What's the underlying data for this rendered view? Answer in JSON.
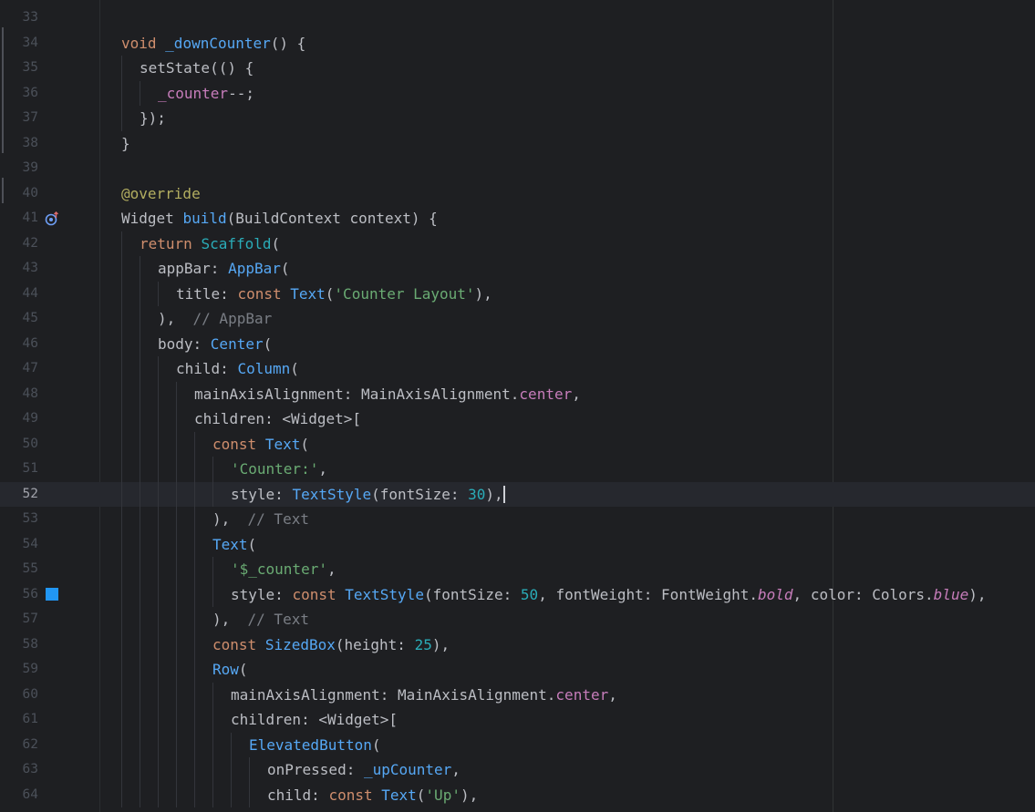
{
  "editor": {
    "current_line": 52,
    "colors": {
      "background": "#1e1f22",
      "keyword": "#cf8e6d",
      "function": "#56a8f5",
      "class": "#2aacb8",
      "string": "#6aab73",
      "number": "#2aacb8",
      "field": "#c77dbb",
      "comment": "#7a7e85",
      "annotation": "#b3ae60",
      "color_swatch": "#2196f3"
    },
    "gutter_icons": {
      "line_41": "override-method-icon",
      "line_56": "color-swatch-icon"
    },
    "lines": [
      {
        "n": "33",
        "indent": 0,
        "tokens": []
      },
      {
        "n": "34",
        "indent": 0,
        "tokens": [
          {
            "t": "void",
            "c": "kw"
          },
          {
            "t": " "
          },
          {
            "t": "_downCounter",
            "c": "fn"
          },
          {
            "t": "() {"
          }
        ]
      },
      {
        "n": "35",
        "indent": 1,
        "tokens": [
          {
            "t": "setState"
          },
          {
            "t": "(() {"
          }
        ]
      },
      {
        "n": "36",
        "indent": 2,
        "tokens": [
          {
            "t": "_counter",
            "c": "field"
          },
          {
            "t": "--;"
          }
        ]
      },
      {
        "n": "37",
        "indent": 1,
        "tokens": [
          {
            "t": "});"
          }
        ]
      },
      {
        "n": "38",
        "indent": 0,
        "tokens": [
          {
            "t": "}"
          }
        ]
      },
      {
        "n": "39",
        "indent": 0,
        "tokens": []
      },
      {
        "n": "40",
        "indent": 0,
        "tokens": [
          {
            "t": "@override",
            "c": "ann"
          }
        ]
      },
      {
        "n": "41",
        "indent": 0,
        "tokens": [
          {
            "t": "Widget"
          },
          {
            "t": " "
          },
          {
            "t": "build",
            "c": "fn"
          },
          {
            "t": "(BuildContext context) {"
          }
        ]
      },
      {
        "n": "42",
        "indent": 1,
        "tokens": [
          {
            "t": "return",
            "c": "kw"
          },
          {
            "t": " "
          },
          {
            "t": "Scaffold",
            "c": "cls"
          },
          {
            "t": "("
          }
        ]
      },
      {
        "n": "43",
        "indent": 2,
        "tokens": [
          {
            "t": "appBar: "
          },
          {
            "t": "AppBar",
            "c": "cls2"
          },
          {
            "t": "("
          }
        ]
      },
      {
        "n": "44",
        "indent": 3,
        "tokens": [
          {
            "t": "title: "
          },
          {
            "t": "const",
            "c": "kw"
          },
          {
            "t": " "
          },
          {
            "t": "Text",
            "c": "cls2"
          },
          {
            "t": "("
          },
          {
            "t": "'Counter Layout'",
            "c": "str"
          },
          {
            "t": "),"
          }
        ]
      },
      {
        "n": "45",
        "indent": 2,
        "tokens": [
          {
            "t": "),  "
          },
          {
            "t": "// AppBar",
            "c": "cmt"
          }
        ]
      },
      {
        "n": "46",
        "indent": 2,
        "tokens": [
          {
            "t": "body: "
          },
          {
            "t": "Center",
            "c": "cls2"
          },
          {
            "t": "("
          }
        ]
      },
      {
        "n": "47",
        "indent": 3,
        "tokens": [
          {
            "t": "child: "
          },
          {
            "t": "Column",
            "c": "cls2"
          },
          {
            "t": "("
          }
        ]
      },
      {
        "n": "48",
        "indent": 4,
        "tokens": [
          {
            "t": "mainAxisAlignment: MainAxisAlignment."
          },
          {
            "t": "center",
            "c": "field"
          },
          {
            "t": ","
          }
        ]
      },
      {
        "n": "49",
        "indent": 4,
        "tokens": [
          {
            "t": "children: <Widget>["
          }
        ]
      },
      {
        "n": "50",
        "indent": 5,
        "tokens": [
          {
            "t": "const",
            "c": "kw"
          },
          {
            "t": " "
          },
          {
            "t": "Text",
            "c": "cls2"
          },
          {
            "t": "("
          }
        ]
      },
      {
        "n": "51",
        "indent": 6,
        "tokens": [
          {
            "t": "'Counter:'",
            "c": "str"
          },
          {
            "t": ","
          }
        ]
      },
      {
        "n": "52",
        "indent": 6,
        "tokens": [
          {
            "t": "style: "
          },
          {
            "t": "TextStyle",
            "c": "cls2"
          },
          {
            "t": "(fontSize: "
          },
          {
            "t": "30",
            "c": "num"
          },
          {
            "t": "),"
          }
        ]
      },
      {
        "n": "53",
        "indent": 5,
        "tokens": [
          {
            "t": "),  "
          },
          {
            "t": "// Text",
            "c": "cmt"
          }
        ]
      },
      {
        "n": "54",
        "indent": 5,
        "tokens": [
          {
            "t": "Text",
            "c": "cls2"
          },
          {
            "t": "("
          }
        ]
      },
      {
        "n": "55",
        "indent": 6,
        "tokens": [
          {
            "t": "'$_counter'",
            "c": "str"
          },
          {
            "t": ","
          }
        ]
      },
      {
        "n": "56",
        "indent": 6,
        "tokens": [
          {
            "t": "style: "
          },
          {
            "t": "const",
            "c": "kw"
          },
          {
            "t": " "
          },
          {
            "t": "TextStyle",
            "c": "cls2"
          },
          {
            "t": "(fontSize: "
          },
          {
            "t": "50",
            "c": "num"
          },
          {
            "t": ", fontWeight: FontWeight."
          },
          {
            "t": "bold",
            "c": "konst"
          },
          {
            "t": ", color: Colors."
          },
          {
            "t": "blue",
            "c": "konst"
          },
          {
            "t": "),"
          }
        ]
      },
      {
        "n": "57",
        "indent": 5,
        "tokens": [
          {
            "t": "),  "
          },
          {
            "t": "// Text",
            "c": "cmt"
          }
        ]
      },
      {
        "n": "58",
        "indent": 5,
        "tokens": [
          {
            "t": "const",
            "c": "kw"
          },
          {
            "t": " "
          },
          {
            "t": "SizedBox",
            "c": "cls2"
          },
          {
            "t": "(height: "
          },
          {
            "t": "25",
            "c": "num"
          },
          {
            "t": "),"
          }
        ]
      },
      {
        "n": "59",
        "indent": 5,
        "tokens": [
          {
            "t": "Row",
            "c": "cls2"
          },
          {
            "t": "("
          }
        ]
      },
      {
        "n": "60",
        "indent": 6,
        "tokens": [
          {
            "t": "mainAxisAlignment: MainAxisAlignment."
          },
          {
            "t": "center",
            "c": "field"
          },
          {
            "t": ","
          }
        ]
      },
      {
        "n": "61",
        "indent": 6,
        "tokens": [
          {
            "t": "children: <Widget>["
          }
        ]
      },
      {
        "n": "62",
        "indent": 7,
        "tokens": [
          {
            "t": "ElevatedButton",
            "c": "cls2"
          },
          {
            "t": "("
          }
        ]
      },
      {
        "n": "63",
        "indent": 8,
        "tokens": [
          {
            "t": "onPressed: "
          },
          {
            "t": "_upCounter",
            "c": "fn"
          },
          {
            "t": ","
          }
        ]
      },
      {
        "n": "64",
        "indent": 8,
        "tokens": [
          {
            "t": "child: "
          },
          {
            "t": "const",
            "c": "kw"
          },
          {
            "t": " "
          },
          {
            "t": "Text",
            "c": "cls2"
          },
          {
            "t": "("
          },
          {
            "t": "'Up'",
            "c": "str"
          },
          {
            "t": "),"
          }
        ]
      }
    ]
  }
}
